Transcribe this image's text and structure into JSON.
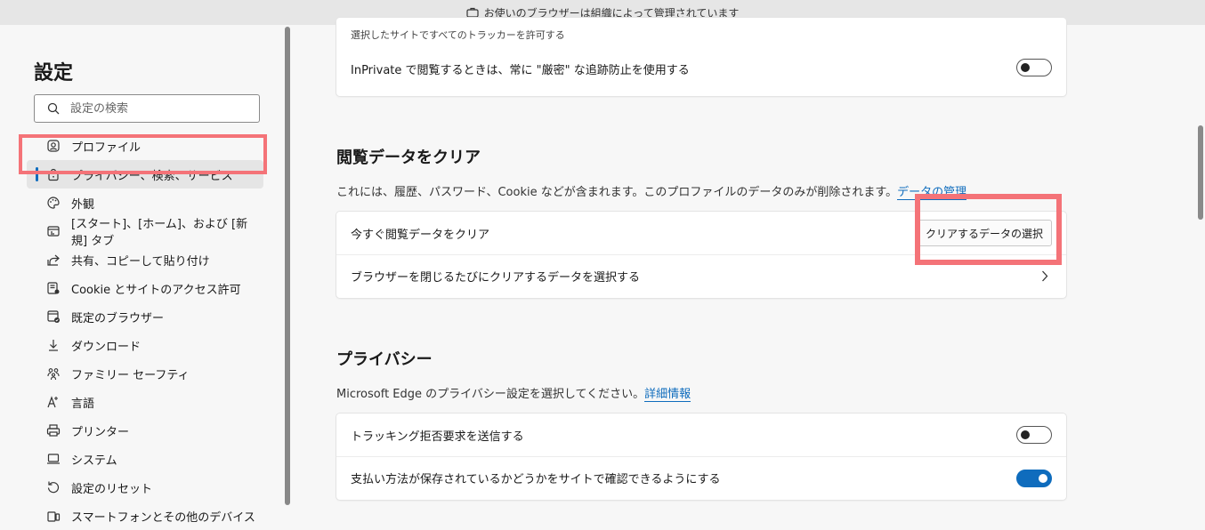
{
  "topbar": {
    "managed_notice": "お使いのブラウザーは組織によって管理されています",
    "icon": "briefcase-icon"
  },
  "sidebar": {
    "title": "設定",
    "search_placeholder": "設定の検索",
    "items": [
      {
        "label": "プロファイル",
        "icon": "profile-icon"
      },
      {
        "label": "プライバシー、検索、サービス",
        "icon": "lock-icon",
        "active": true
      },
      {
        "label": "外観",
        "icon": "palette-icon"
      },
      {
        "label": "[スタート]、[ホーム]、および [新規] タブ",
        "icon": "home-tab-icon"
      },
      {
        "label": "共有、コピーして貼り付け",
        "icon": "share-icon"
      },
      {
        "label": "Cookie とサイトのアクセス許可",
        "icon": "site-permissions-icon"
      },
      {
        "label": "既定のブラウザー",
        "icon": "default-browser-icon"
      },
      {
        "label": "ダウンロード",
        "icon": "download-icon"
      },
      {
        "label": "ファミリー セーフティ",
        "icon": "family-icon"
      },
      {
        "label": "言語",
        "icon": "language-icon"
      },
      {
        "label": "プリンター",
        "icon": "printer-icon"
      },
      {
        "label": "システム",
        "icon": "system-icon"
      },
      {
        "label": "設定のリセット",
        "icon": "reset-icon"
      },
      {
        "label": "スマートフォンとその他のデバイス",
        "icon": "phone-icon"
      }
    ]
  },
  "main": {
    "top_card": {
      "partial_text": "選択したサイトですべてのトラッカーを許可する",
      "inprivate_label": "InPrivate で閲覧するときは、常に \"厳密\" な追跡防止を使用する",
      "inprivate_toggle": "off"
    },
    "clear_section": {
      "title": "閲覧データをクリア",
      "desc": "これには、履歴、パスワード、Cookie などが含まれます。このプロファイルのデータのみが削除されます。",
      "link": "データの管理",
      "row1_label": "今すぐ閲覧データをクリア",
      "row1_button": "クリアするデータの選択",
      "row2_label": "ブラウザーを閉じるたびにクリアするデータを選択する"
    },
    "privacy_section": {
      "title": "プライバシー",
      "desc": "Microsoft Edge のプライバシー設定を選択してください。",
      "link": "詳細情報",
      "row1_label": "トラッキング拒否要求を送信する",
      "row1_toggle": "off",
      "row2_label": "支払い方法が保存されているかどうかをサイトで確認できるようにする",
      "row2_toggle": "on"
    }
  },
  "colors": {
    "accent": "#0f6cbd",
    "highlight": "#f47378"
  }
}
